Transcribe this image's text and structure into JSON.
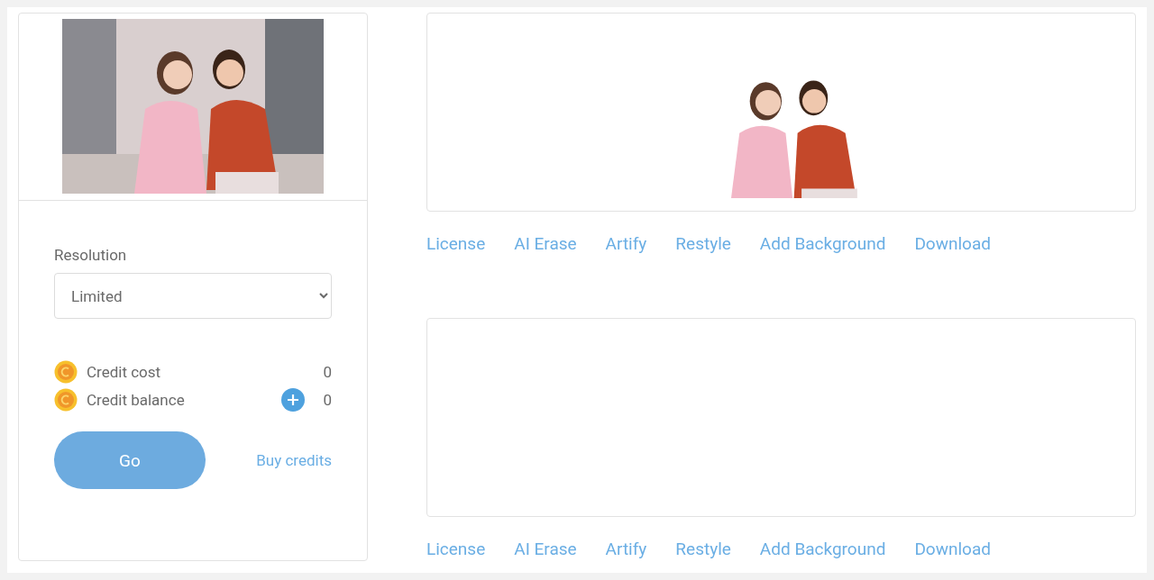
{
  "resolution": {
    "label": "Resolution",
    "value": "Limited"
  },
  "credits": [
    {
      "kind": "cost",
      "label": "Credit cost",
      "value": "0"
    },
    {
      "kind": "balance",
      "label": "Credit balance",
      "value": "0"
    }
  ],
  "go_button": "Go",
  "buy_link": "Buy credits",
  "results": [
    {
      "actions": [
        "License",
        "AI Erase",
        "Artify",
        "Restyle",
        "Add Background",
        "Download"
      ]
    },
    {
      "actions": [
        "License",
        "AI Erase",
        "Artify",
        "Restyle",
        "Add Background",
        "Download"
      ]
    }
  ]
}
